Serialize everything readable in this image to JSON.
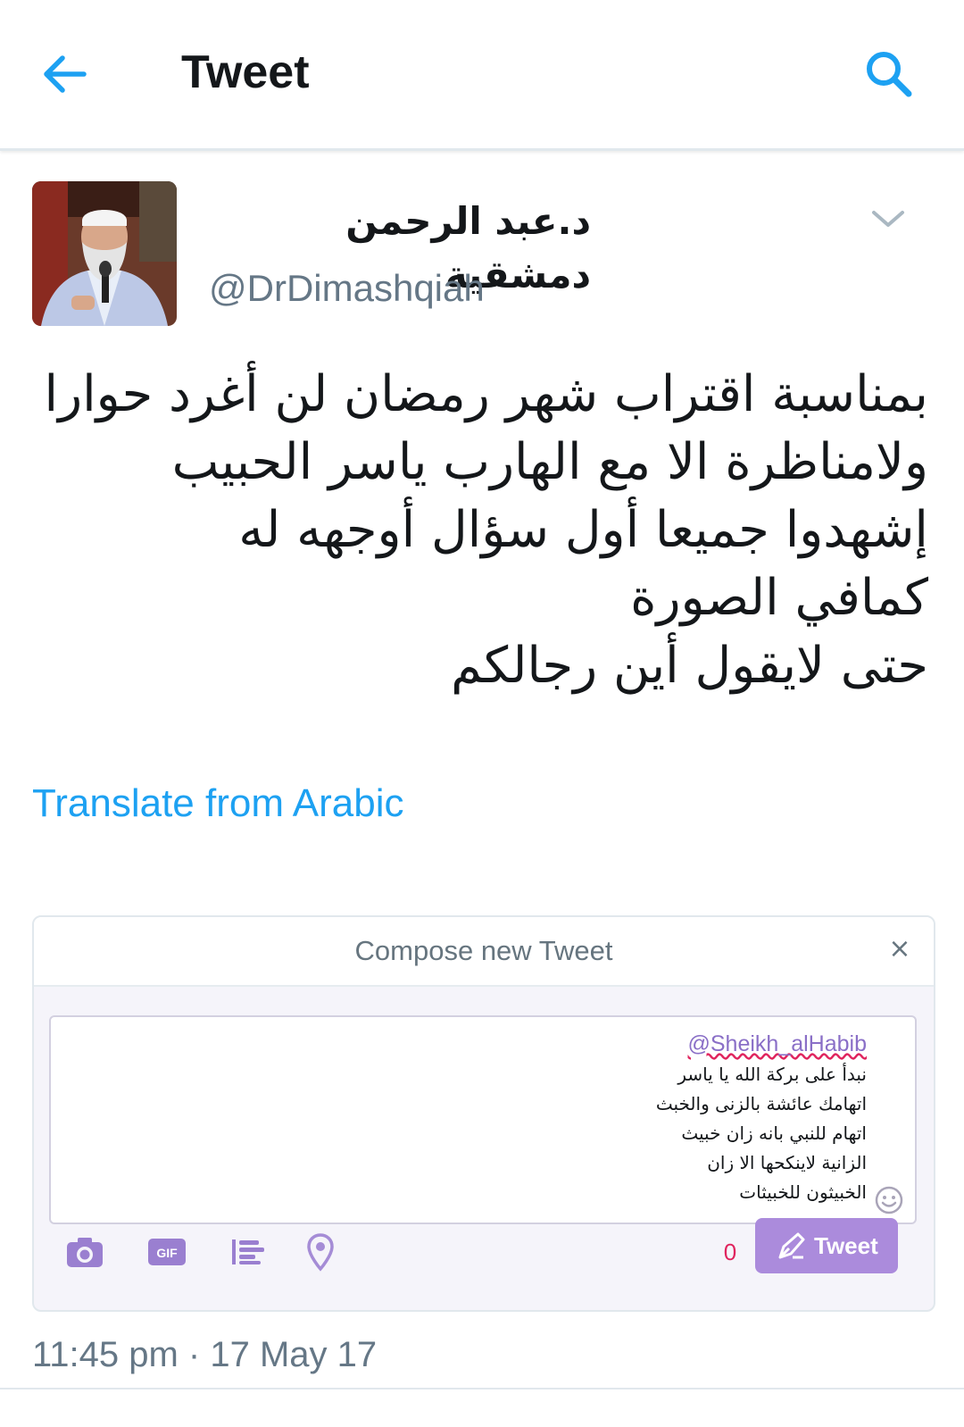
{
  "header": {
    "title": "Tweet",
    "back_icon": "back-arrow-icon",
    "search_icon": "search-icon",
    "accent_color": "#1da1f2"
  },
  "tweet": {
    "author": {
      "display_name": "د.عبد الرحمن دمشقية",
      "handle": "@DrDimashqiah"
    },
    "text_lines": [
      "بمناسبة اقتراب شهر رمضان لن أغرد حوارا",
      "ولامناظرة الا مع الهارب ياسر الحبيب",
      "إشهدوا جميعا أول سؤال أوجهه له",
      "كمافي الصورة",
      "حتى لايقول أين رجالكم"
    ],
    "translate_label": "Translate from Arabic",
    "timestamp": "11:45 pm · 17 May 17"
  },
  "compose": {
    "title": "Compose new Tweet",
    "close_label": "×",
    "mention": "@Sheikh_alHabib",
    "lines": [
      "نبدأ على بركة الله يا ياسر",
      "اتهامك عائشة بالزنى والخبث",
      "اتهام للنبي بانه زان خبيث",
      "الزانية لاينكحها الا زان",
      "الخبيثون للخبيثات"
    ],
    "char_count": "0",
    "submit_label": "Tweet",
    "accent_color": "#ab8bdc",
    "toolbar_icons": [
      "camera-icon",
      "gif-icon",
      "poll-icon",
      "location-pin-icon"
    ]
  }
}
